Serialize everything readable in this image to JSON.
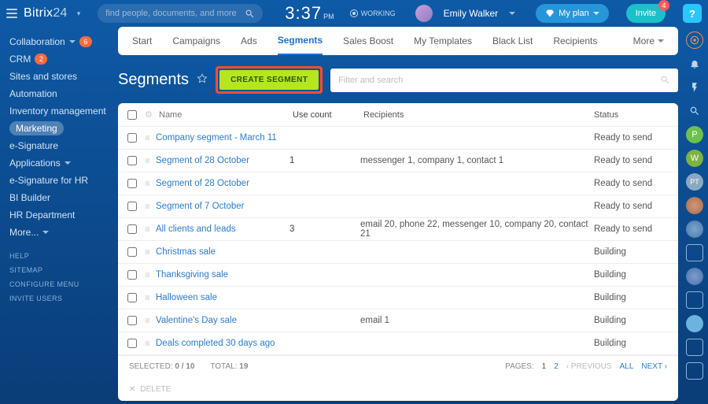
{
  "header": {
    "logo_a": "Bitrix",
    "logo_b": "24",
    "search_placeholder": "find people, documents, and more",
    "time": "3:37",
    "ampm": "PM",
    "working": "WORKING",
    "user": "Emily Walker",
    "plan": "My plan",
    "invite": "Invite",
    "invite_count": "4",
    "help": "?"
  },
  "sidebar": {
    "items": [
      {
        "label": "Collaboration",
        "chev": true,
        "badge": "6"
      },
      {
        "label": "CRM",
        "badge": "2"
      },
      {
        "label": "Sites and stores"
      },
      {
        "label": "Automation"
      },
      {
        "label": "Inventory management"
      },
      {
        "label": "Marketing",
        "active": true
      },
      {
        "label": "e-Signature"
      },
      {
        "label": "Applications",
        "chev": true
      },
      {
        "label": "e-Signature for HR"
      },
      {
        "label": "BI Builder"
      },
      {
        "label": "HR Department"
      },
      {
        "label": "More...",
        "chev": true
      }
    ],
    "footer": [
      "HELP",
      "SITEMAP",
      "CONFIGURE MENU",
      "INVITE USERS"
    ]
  },
  "tabs": [
    "Start",
    "Campaigns",
    "Ads",
    "Segments",
    "Sales Boost",
    "My Templates",
    "Black List",
    "Recipients"
  ],
  "tabs_more": "More",
  "tabs_active": 3,
  "page": {
    "title": "Segments",
    "create": "CREATE SEGMENT",
    "filter_placeholder": "Filter and search"
  },
  "grid": {
    "columns": {
      "name": "Name",
      "use": "Use count",
      "recipients": "Recipients",
      "status": "Status"
    },
    "rows": [
      {
        "name": "Company segment - March 11",
        "use": "",
        "recipients": "",
        "status": "Ready to send"
      },
      {
        "name": "Segment of 28 October",
        "use": "1",
        "recipients": "messenger 1, company 1, contact 1",
        "status": "Ready to send"
      },
      {
        "name": "Segment of 28 October",
        "use": "",
        "recipients": "",
        "status": "Ready to send"
      },
      {
        "name": "Segment of 7 October",
        "use": "",
        "recipients": "",
        "status": "Ready to send"
      },
      {
        "name": "All clients and leads",
        "use": "3",
        "recipients": "email 20, phone 22, messenger 10, company 20, contact 21",
        "status": "Ready to send"
      },
      {
        "name": "Christmas sale",
        "use": "",
        "recipients": "",
        "status": "Building"
      },
      {
        "name": "Thanksgiving sale",
        "use": "",
        "recipients": "",
        "status": "Building"
      },
      {
        "name": "Halloween sale",
        "use": "",
        "recipients": "",
        "status": "Building"
      },
      {
        "name": "Valentine's Day sale",
        "use": "",
        "recipients": "email 1",
        "status": "Building"
      },
      {
        "name": "Deals completed 30 days ago",
        "use": "",
        "recipients": "",
        "status": "Building"
      }
    ],
    "footer": {
      "selected_label": "SELECTED:",
      "selected": "0 / 10",
      "total_label": "TOTAL:",
      "total": "19",
      "pages_label": "PAGES:",
      "page1": "1",
      "page2": "2",
      "prev": "PREVIOUS",
      "all": "ALL",
      "next": "NEXT",
      "delete": "DELETE"
    }
  }
}
